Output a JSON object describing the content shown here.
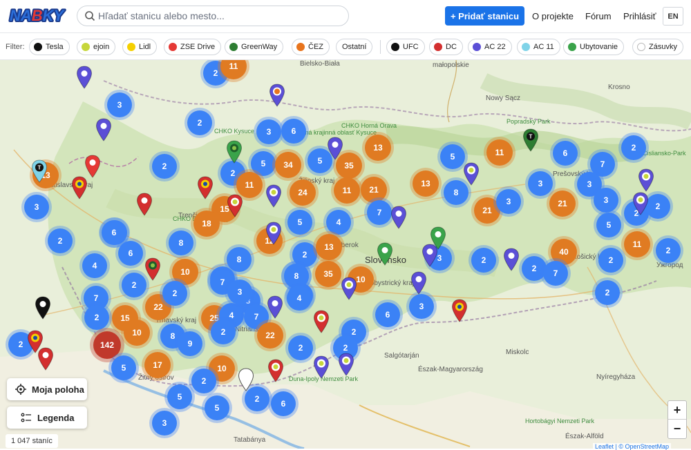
{
  "header": {
    "logo_text": "NABKY",
    "search_placeholder": "Hľadať stanicu alebo mesto...",
    "add_button": "+ Pridať stanicu",
    "nav": [
      "O projekte",
      "Fórum",
      "Prihlásiť"
    ],
    "lang": "EN"
  },
  "filters": {
    "label": "Filter:",
    "operators": [
      {
        "label": "Tesla",
        "color": "#111111"
      },
      {
        "label": "ejoin",
        "color": "#c6d63a"
      },
      {
        "label": "Lidl",
        "color": "#f5d000"
      },
      {
        "label": "ZSE Drive",
        "color": "#e53935"
      },
      {
        "label": "GreenWay",
        "color": "#2e7d32"
      },
      {
        "label": "ČEZ",
        "color": "#e8741c"
      },
      {
        "label": "Ostatní",
        "color": ""
      }
    ],
    "types": [
      {
        "label": "UFC",
        "color": "#111111"
      },
      {
        "label": "DC",
        "color": "#d32f2f"
      },
      {
        "label": "AC 22",
        "color": "#5b4fd6"
      },
      {
        "label": "AC 11",
        "color": "#7fd3e8"
      },
      {
        "label": "Ubytovanie",
        "color": "#3aa34a"
      },
      {
        "label": "Zásuvky",
        "color": "#ffffff"
      }
    ]
  },
  "map": {
    "place_labels": [
      "Bielsko-Biała",
      "małopolskie",
      "Krosno",
      "Nowy Sącz",
      "CHKO Kysuce",
      "Chránená krajinná oblasť Kysuce",
      "CHKO Horná Orava",
      "Popradský Park",
      "Slovensko",
      "Ružomberok",
      "CHKO Biele Karpaty",
      "Bratislavský kraj",
      "Trnavský kraj",
      "Nitriansky kraj",
      "Žitný ostrov",
      "Salgótarján",
      "Észak-Magyarország",
      "Miskolc",
      "Nyíregyháza",
      "Ужгород",
      "Tatabánya",
      "Duna-Ipoly Nemzeti Park",
      "Hortobágyi Nemzeti Park",
      "Észak-Alföld",
      "Cisliansko-Park",
      "Prešovský kraj",
      "Košický kraj",
      "Banskobystrický kraj",
      "Trenčiansky kraj",
      "Žilinský kraj"
    ],
    "clusters": [
      {
        "n": "2",
        "c": "blue"
      },
      {
        "n": "11",
        "c": "orange"
      },
      {
        "n": "3",
        "c": "blue"
      },
      {
        "n": "2",
        "c": "blue"
      },
      {
        "n": "3",
        "c": "blue"
      },
      {
        "n": "6",
        "c": "blue"
      },
      {
        "n": "13",
        "c": "orange"
      },
      {
        "n": "2",
        "c": "blue"
      },
      {
        "n": "5",
        "c": "blue"
      },
      {
        "n": "34",
        "c": "orange"
      },
      {
        "n": "5",
        "c": "blue"
      },
      {
        "n": "35",
        "c": "orange"
      },
      {
        "n": "2",
        "c": "blue"
      },
      {
        "n": "11",
        "c": "orange"
      },
      {
        "n": "24",
        "c": "orange"
      },
      {
        "n": "11",
        "c": "orange"
      },
      {
        "n": "21",
        "c": "orange"
      },
      {
        "n": "15",
        "c": "orange"
      },
      {
        "n": "18",
        "c": "orange"
      },
      {
        "n": "5",
        "c": "blue"
      },
      {
        "n": "4",
        "c": "blue"
      },
      {
        "n": "7",
        "c": "blue"
      },
      {
        "n": "6",
        "c": "blue"
      },
      {
        "n": "2",
        "c": "blue"
      },
      {
        "n": "5",
        "c": "blue"
      },
      {
        "n": "13",
        "c": "orange"
      },
      {
        "n": "8",
        "c": "blue"
      },
      {
        "n": "21",
        "c": "orange"
      },
      {
        "n": "11",
        "c": "orange"
      },
      {
        "n": "6",
        "c": "blue"
      },
      {
        "n": "7",
        "c": "blue"
      },
      {
        "n": "3",
        "c": "blue"
      },
      {
        "n": "3",
        "c": "blue"
      },
      {
        "n": "2",
        "c": "blue"
      },
      {
        "n": "21",
        "c": "orange"
      },
      {
        "n": "3",
        "c": "blue"
      },
      {
        "n": "3",
        "c": "blue"
      },
      {
        "n": "5",
        "c": "blue"
      },
      {
        "n": "2",
        "c": "blue"
      },
      {
        "n": "2",
        "c": "blue"
      },
      {
        "n": "3",
        "c": "blue"
      },
      {
        "n": "6",
        "c": "blue"
      },
      {
        "n": "6",
        "c": "blue"
      },
      {
        "n": "8",
        "c": "blue"
      },
      {
        "n": "12",
        "c": "orange"
      },
      {
        "n": "2",
        "c": "blue"
      },
      {
        "n": "13",
        "c": "orange"
      },
      {
        "n": "4",
        "c": "blue"
      },
      {
        "n": "10",
        "c": "orange"
      },
      {
        "n": "8",
        "c": "blue"
      },
      {
        "n": "35",
        "c": "orange"
      },
      {
        "n": "10",
        "c": "orange"
      },
      {
        "n": "8",
        "c": "blue"
      },
      {
        "n": "3",
        "c": "blue"
      },
      {
        "n": "2",
        "c": "blue"
      },
      {
        "n": "40",
        "c": "orange"
      },
      {
        "n": "11",
        "c": "orange"
      },
      {
        "n": "2",
        "c": "blue"
      },
      {
        "n": "2",
        "c": "blue"
      },
      {
        "n": "2",
        "c": "blue"
      },
      {
        "n": "7",
        "c": "blue"
      },
      {
        "n": "2",
        "c": "blue"
      },
      {
        "n": "22",
        "c": "orange"
      },
      {
        "n": "7",
        "c": "blue"
      },
      {
        "n": "3",
        "c": "blue"
      },
      {
        "n": "4",
        "c": "blue"
      },
      {
        "n": "2",
        "c": "blue"
      },
      {
        "n": "7",
        "c": "blue"
      },
      {
        "n": "6",
        "c": "blue"
      },
      {
        "n": "3",
        "c": "blue"
      },
      {
        "n": "15",
        "c": "orange"
      },
      {
        "n": "10",
        "c": "orange"
      },
      {
        "n": "25",
        "c": "orange"
      },
      {
        "n": "4",
        "c": "blue"
      },
      {
        "n": "7",
        "c": "blue"
      },
      {
        "n": "8",
        "c": "blue"
      },
      {
        "n": "9",
        "c": "blue"
      },
      {
        "n": "2",
        "c": "blue"
      },
      {
        "n": "22",
        "c": "orange"
      },
      {
        "n": "2",
        "c": "blue"
      },
      {
        "n": "2",
        "c": "blue"
      },
      {
        "n": "142",
        "c": "red"
      },
      {
        "n": "5",
        "c": "blue"
      },
      {
        "n": "17",
        "c": "orange"
      },
      {
        "n": "10",
        "c": "orange"
      },
      {
        "n": "2",
        "c": "blue"
      },
      {
        "n": "5",
        "c": "blue"
      },
      {
        "n": "5",
        "c": "blue"
      },
      {
        "n": "2",
        "c": "blue"
      },
      {
        "n": "6",
        "c": "blue"
      },
      {
        "n": "3",
        "c": "blue"
      },
      {
        "n": "2",
        "c": "blue"
      },
      {
        "n": "7",
        "c": "blue"
      },
      {
        "n": "3",
        "c": "blue"
      },
      {
        "n": "13",
        "c": "orange"
      },
      {
        "n": "2",
        "c": "blue"
      },
      {
        "n": "8",
        "c": "blue"
      },
      {
        "n": "4",
        "c": "blue"
      },
      {
        "n": "2",
        "c": "blue"
      },
      {
        "n": "2",
        "c": "blue"
      }
    ]
  },
  "controls": {
    "locate": "Moja poloha",
    "legend": "Legenda",
    "count": "1 047 staníc",
    "zoom_in": "+",
    "zoom_out": "−",
    "attribution": "Leaflet | © OpenStreetMap"
  }
}
